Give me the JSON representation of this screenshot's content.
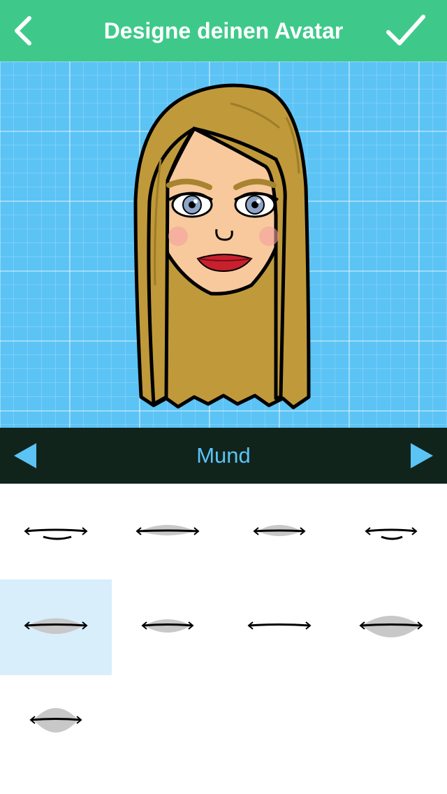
{
  "header": {
    "title": "Designe deinen Avatar",
    "back_icon": "chevron-left-icon",
    "done_icon": "checkmark-icon",
    "color": "#3ec98a"
  },
  "category": {
    "label": "Mund",
    "prev_icon": "triangle-left-icon",
    "next_icon": "triangle-right-icon",
    "bar_color": "#10241c",
    "accent": "#5cc3f5"
  },
  "mouth_options": {
    "count": 9,
    "selected_index": 4,
    "items": [
      "mouth-1",
      "mouth-2",
      "mouth-3",
      "mouth-4",
      "mouth-5",
      "mouth-6",
      "mouth-7",
      "mouth-8",
      "mouth-9"
    ]
  }
}
